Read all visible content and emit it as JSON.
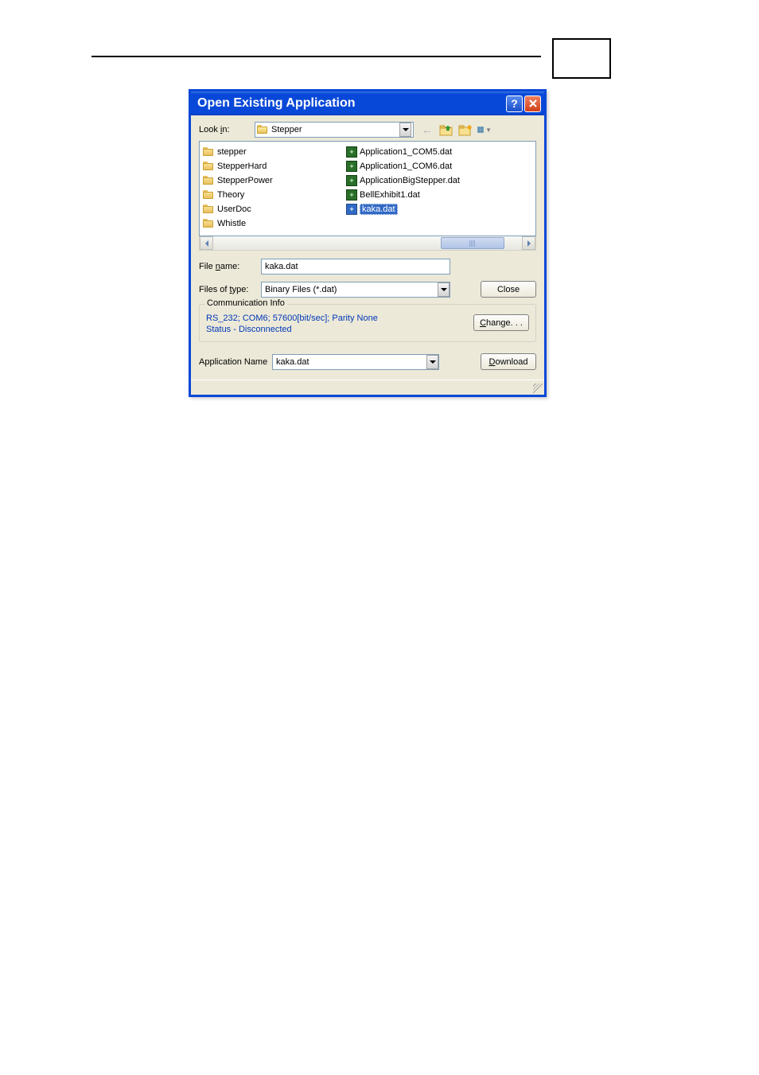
{
  "dialog": {
    "title": "Open Existing Application",
    "look_in_label": "Look in:",
    "look_in_value": "Stepper",
    "folders": [
      "stepper",
      "StepperHard",
      "StepperPower",
      "Theory",
      "UserDoc",
      "Whistle"
    ],
    "files": [
      "Application1_COM5.dat",
      "Application1_COM6.dat",
      "ApplicationBigStepper.dat",
      "BellExhibit1.dat",
      "kaka.dat"
    ],
    "selected_file": "kaka.dat",
    "filename_label": "File name:",
    "filename_value": "kaka.dat",
    "filetype_label": "Files of type:",
    "filetype_value": "Binary Files (*.dat)",
    "close_btn": "Close",
    "comm_legend": "Communication Info",
    "comm_line1": "RS_232; COM6; 57600[bit/sec]; Parity None",
    "comm_line2": "Status - Disconnected",
    "change_btn": "Change. . .",
    "appname_label": "Application Name",
    "appname_value": "kaka.dat",
    "download_btn": "Download"
  }
}
